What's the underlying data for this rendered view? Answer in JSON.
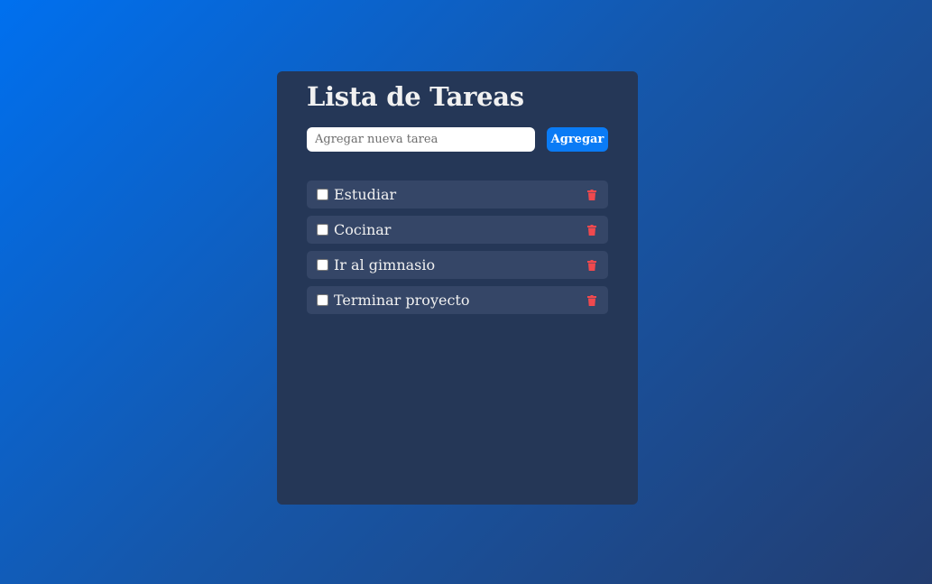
{
  "app": {
    "title": "Lista de Tareas"
  },
  "form": {
    "input_value": "",
    "input_placeholder": "Agregar nueva tarea",
    "add_label": "Agregar"
  },
  "tasks": [
    {
      "text": "Estudiar",
      "done": false
    },
    {
      "text": "Cocinar",
      "done": false
    },
    {
      "text": "Ir al gimnasio",
      "done": false
    },
    {
      "text": "Terminar proyecto",
      "done": false
    }
  ],
  "icons": {
    "delete": "trash-icon"
  },
  "colors": {
    "card_bg": "#253757",
    "item_bg": "#354667",
    "accent": "#0a7bf5",
    "delete": "#f0494e"
  }
}
